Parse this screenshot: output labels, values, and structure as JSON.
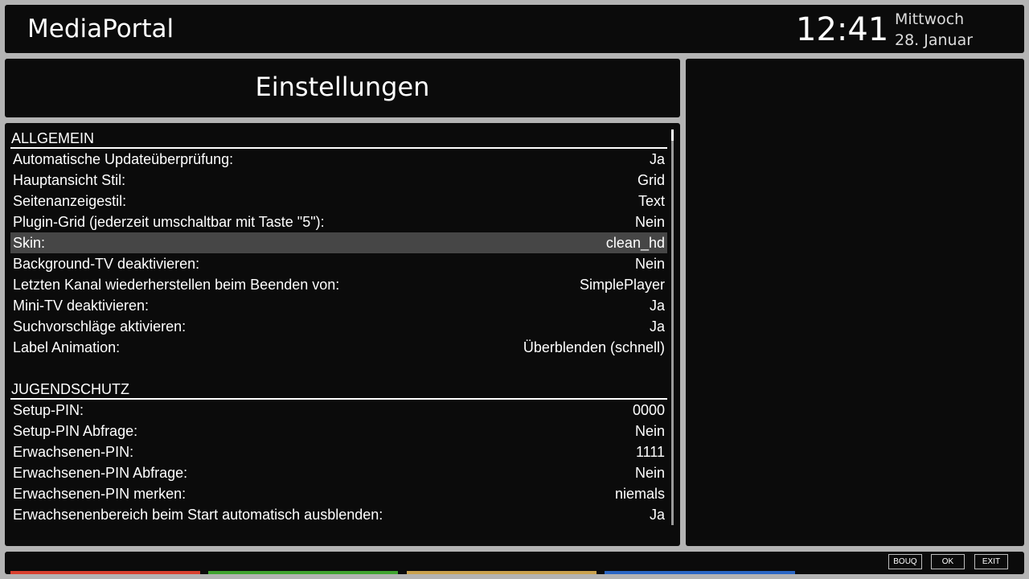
{
  "header": {
    "app_title": "MediaPortal",
    "time": "12:41",
    "weekday": "Mittwoch",
    "date": "28. Januar"
  },
  "screen_title": "Einstellungen",
  "sections": [
    {
      "title": "ALLGEMEIN",
      "rows": [
        {
          "label": "Automatische Updateüberprüfung:",
          "value": "Ja"
        },
        {
          "label": "Hauptansicht Stil:",
          "value": "Grid"
        },
        {
          "label": "Seitenanzeigestil:",
          "value": "Text"
        },
        {
          "label": "Plugin-Grid (jederzeit umschaltbar mit Taste \"5\"):",
          "value": "Nein"
        },
        {
          "label": "Skin:",
          "value": "clean_hd",
          "selected": true
        },
        {
          "label": "Background-TV deaktivieren:",
          "value": "Nein"
        },
        {
          "label": "Letzten Kanal wiederherstellen beim Beenden von:",
          "value": "SimplePlayer"
        },
        {
          "label": "Mini-TV deaktivieren:",
          "value": "Ja"
        },
        {
          "label": "Suchvorschläge aktivieren:",
          "value": "Ja"
        },
        {
          "label": "Label Animation:",
          "value": "Überblenden (schnell)"
        }
      ]
    },
    {
      "title": "JUGENDSCHUTZ",
      "rows": [
        {
          "label": "Setup-PIN:",
          "value": "0000"
        },
        {
          "label": "Setup-PIN Abfrage:",
          "value": "Nein"
        },
        {
          "label": "Erwachsenen-PIN:",
          "value": "1111"
        },
        {
          "label": "Erwachsenen-PIN Abfrage:",
          "value": "Nein"
        },
        {
          "label": "Erwachsenen-PIN merken:",
          "value": "niemals"
        },
        {
          "label": "Erwachsenenbereich beim Start automatisch ausblenden:",
          "value": "Ja"
        }
      ]
    }
  ],
  "footer": {
    "buttons": {
      "bouq": "BOUQ",
      "ok": "OK",
      "exit": "EXIT"
    },
    "color_keys": {
      "red": "#d8402e",
      "green": "#3fa32f",
      "yellow": "#caa24e",
      "blue": "#2a66c4"
    }
  },
  "colors": {
    "background": "#b4b4b4",
    "panel": "#0b0b0b",
    "selection": "#464646"
  }
}
